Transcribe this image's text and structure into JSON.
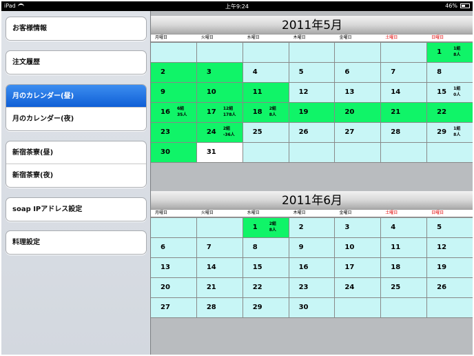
{
  "status": {
    "device": "iPad",
    "time": "上午9:24",
    "battery": "46%"
  },
  "sidebar": {
    "groups": [
      [
        {
          "label": "お客様情報"
        }
      ],
      [
        {
          "label": "注文履歴"
        }
      ],
      [
        {
          "label": "月のカレンダー(昼)",
          "selected": true
        },
        {
          "label": "月のカレンダー(夜)"
        }
      ],
      [
        {
          "label": "新宿茶寮(昼)"
        },
        {
          "label": "新宿茶寮(夜)"
        }
      ],
      [
        {
          "label": "soap IPアドレス設定"
        }
      ],
      [
        {
          "label": "料理設定"
        }
      ]
    ]
  },
  "weekdays": [
    "月曜日",
    "火曜日",
    "水曜日",
    "木曜日",
    "金曜日",
    "土曜日",
    "日曜日"
  ],
  "calendars": [
    {
      "title": "2011年5月",
      "cells": [
        {},
        {},
        {},
        {},
        {},
        {},
        {
          "n": "1",
          "hl": true,
          "note": [
            "1組",
            "8人"
          ]
        },
        {
          "n": "2",
          "hl": true
        },
        {
          "n": "3",
          "hl": true
        },
        {
          "n": "4"
        },
        {
          "n": "5"
        },
        {
          "n": "6"
        },
        {
          "n": "7"
        },
        {
          "n": "8"
        },
        {
          "n": "9",
          "hl": true
        },
        {
          "n": "10",
          "hl": true
        },
        {
          "n": "11",
          "hl": true
        },
        {
          "n": "12"
        },
        {
          "n": "13"
        },
        {
          "n": "14"
        },
        {
          "n": "15",
          "note": [
            "1組",
            "0人"
          ]
        },
        {
          "n": "16",
          "hl": true,
          "note": [
            "6組",
            "35人"
          ]
        },
        {
          "n": "17",
          "hl": true,
          "note": [
            "12組",
            "178人"
          ]
        },
        {
          "n": "18",
          "hl": true,
          "note": [
            "2組",
            "8人"
          ]
        },
        {
          "n": "19",
          "hl": true
        },
        {
          "n": "20",
          "hl": true
        },
        {
          "n": "21",
          "hl": true
        },
        {
          "n": "22",
          "hl": true
        },
        {
          "n": "23",
          "hl": true
        },
        {
          "n": "24",
          "hl": true,
          "note": [
            "2組",
            "-36人"
          ]
        },
        {
          "n": "25"
        },
        {
          "n": "26"
        },
        {
          "n": "27"
        },
        {
          "n": "28"
        },
        {
          "n": "29",
          "note": [
            "1組",
            "8人"
          ]
        },
        {
          "n": "30",
          "hl": true
        },
        {
          "n": "31",
          "white": true
        },
        {},
        {},
        {},
        {},
        {}
      ]
    },
    {
      "title": "2011年6月",
      "cells": [
        {},
        {},
        {
          "n": "1",
          "hl": true,
          "note": [
            "2組",
            "8人"
          ]
        },
        {
          "n": "2"
        },
        {
          "n": "3"
        },
        {
          "n": "4"
        },
        {
          "n": "5"
        },
        {
          "n": "6"
        },
        {
          "n": "7"
        },
        {
          "n": "8"
        },
        {
          "n": "9"
        },
        {
          "n": "10"
        },
        {
          "n": "11"
        },
        {
          "n": "12"
        },
        {
          "n": "13"
        },
        {
          "n": "14"
        },
        {
          "n": "15"
        },
        {
          "n": "16"
        },
        {
          "n": "17"
        },
        {
          "n": "18"
        },
        {
          "n": "19"
        },
        {
          "n": "20"
        },
        {
          "n": "21"
        },
        {
          "n": "22"
        },
        {
          "n": "23"
        },
        {
          "n": "24"
        },
        {
          "n": "25"
        },
        {
          "n": "26"
        },
        {
          "n": "27"
        },
        {
          "n": "28"
        },
        {
          "n": "29"
        },
        {
          "n": "30"
        },
        {},
        {},
        {}
      ]
    }
  ],
  "colors": {
    "highlight": "#10f468",
    "cell": "#c8f6f6",
    "selected": "#1a6fe0",
    "weekend": "#e00000"
  }
}
